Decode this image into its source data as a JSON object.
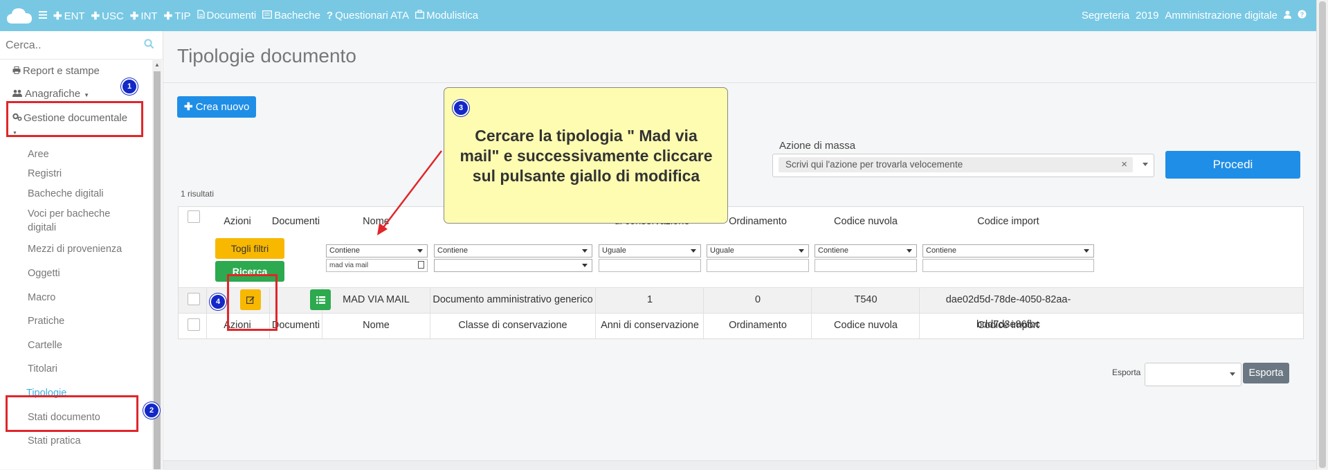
{
  "topbar": {
    "nav": [
      {
        "icon": "bars-icon",
        "label": ""
      },
      {
        "icon": "plus-icon",
        "label": "ENT"
      },
      {
        "icon": "plus-icon",
        "label": "USC"
      },
      {
        "icon": "plus-icon",
        "label": "INT"
      },
      {
        "icon": "plus-icon",
        "label": "TIP"
      },
      {
        "icon": "file-icon",
        "label": "Documenti"
      },
      {
        "icon": "board-icon",
        "label": "Bacheche"
      },
      {
        "icon": "question-icon",
        "label": "Questionari ATA"
      },
      {
        "icon": "briefcase-icon",
        "label": "Modulistica"
      }
    ],
    "right": {
      "office": "Segreteria",
      "year": "2019",
      "section": "Amministrazione digitale"
    },
    "bar_color": "#78c8e4"
  },
  "sidebar": {
    "search_placeholder": "Cerca..",
    "top_items": [
      {
        "label": "Report e stampe",
        "icon": "print-icon"
      },
      {
        "label": "Anagrafiche",
        "icon": "users-icon"
      },
      {
        "label": "Gestione documentale",
        "icon": "cogs-icon"
      }
    ],
    "sub_items": [
      "Aree",
      "Registri",
      "Bacheche digitali",
      "Voci per bacheche digitali",
      "Mezzi di provenienza",
      "Oggetti",
      "Macro",
      "Pratiche",
      "Cartelle",
      "Titolari",
      "Tipologie",
      "Stati documento",
      "Stati pratica"
    ],
    "active_item": "Tipologie",
    "active_color": "#3db0df"
  },
  "main": {
    "title": "Tipologie documento",
    "create_label": "Crea nuovo",
    "mass_action": {
      "label": "Azione di massa",
      "placeholder": "Scrivi qui l'azione per trovarla velocemente",
      "clear": "×"
    },
    "proceed_label": "Procedi",
    "results_text": "1 risultati",
    "filters_buttons": {
      "clear": "Togli filtri",
      "search": "Ricerca"
    },
    "table": {
      "headers": [
        "Azioni",
        "Documenti",
        "Nome",
        "Classe di conservazione",
        "Anni di conservazione",
        "Ordinamento",
        "Codice nuvola",
        "Codice import"
      ],
      "visible_header_labels": {
        "anni": "di conservazione"
      },
      "filters": {
        "nome": {
          "op": "Contiene",
          "value": "mad via mail"
        },
        "classe": {
          "op": "Contiene",
          "value": ""
        },
        "anni": {
          "op": "Uguale",
          "value": ""
        },
        "ordinamento": {
          "op": "Uguale",
          "value": ""
        },
        "codice_nuvola": {
          "op": "Contiene",
          "value": ""
        },
        "codice_import": {
          "op": "Contiene",
          "value": ""
        }
      },
      "rows": [
        {
          "nome": "MAD VIA MAIL",
          "classe": "Documento amministrativo generico",
          "anni": "1",
          "ordinamento": "0",
          "codice_nuvola": "T540",
          "codice_import": "dae02d5d-78de-4050-82aa-bdd7d3e86fbc"
        }
      ]
    },
    "export": {
      "label": "Esporta",
      "button": "Esporta"
    }
  },
  "annotations": {
    "badges": [
      "1",
      "2",
      "3",
      "4"
    ],
    "callout_text": "Cercare la tipologia \" Mad via mail\" e successivamente cliccare sul pulsante giallo di modifica",
    "highlight_color": "#e0262a",
    "callout_color": "#fdfcb1"
  }
}
